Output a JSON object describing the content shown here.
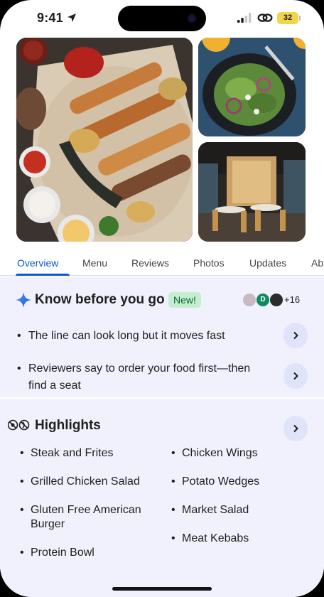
{
  "status_bar": {
    "time": "9:41",
    "battery": "32",
    "icons": [
      "location-arrow-icon",
      "signal-icon",
      "link-icon",
      "battery-icon"
    ]
  },
  "photos": [
    {
      "name": "grilled-platter-photo"
    },
    {
      "name": "salad-photo"
    },
    {
      "name": "restaurant-interior-photo"
    }
  ],
  "tabs": [
    {
      "label": "Overview",
      "active": true
    },
    {
      "label": "Menu"
    },
    {
      "label": "Reviews"
    },
    {
      "label": "Photos"
    },
    {
      "label": "Updates"
    },
    {
      "label": "Ab"
    }
  ],
  "know": {
    "title": "Know before you go",
    "badge": "New!",
    "avatar_letter": "D",
    "more_count": "+16",
    "tips": [
      "The line can look long but it moves fast",
      "Reviewers say to order your food first—then find a seat"
    ]
  },
  "highlights": {
    "title": "Highlights",
    "left": [
      "Steak and Frites",
      "Grilled Chicken Salad",
      "Gluten Free American Burger",
      "Protein Bowl"
    ],
    "right": [
      "Chicken Wings",
      "Potato Wedges",
      "Market Salad",
      "Meat Kebabs"
    ]
  },
  "colors": {
    "accent": "#0b57d0",
    "section_bg": "#f0f1fd",
    "badge_bg": "#c4eed0",
    "badge_text": "#0d652d",
    "chevron_bg": "#dfe4fa",
    "battery": "#f2d44a"
  }
}
